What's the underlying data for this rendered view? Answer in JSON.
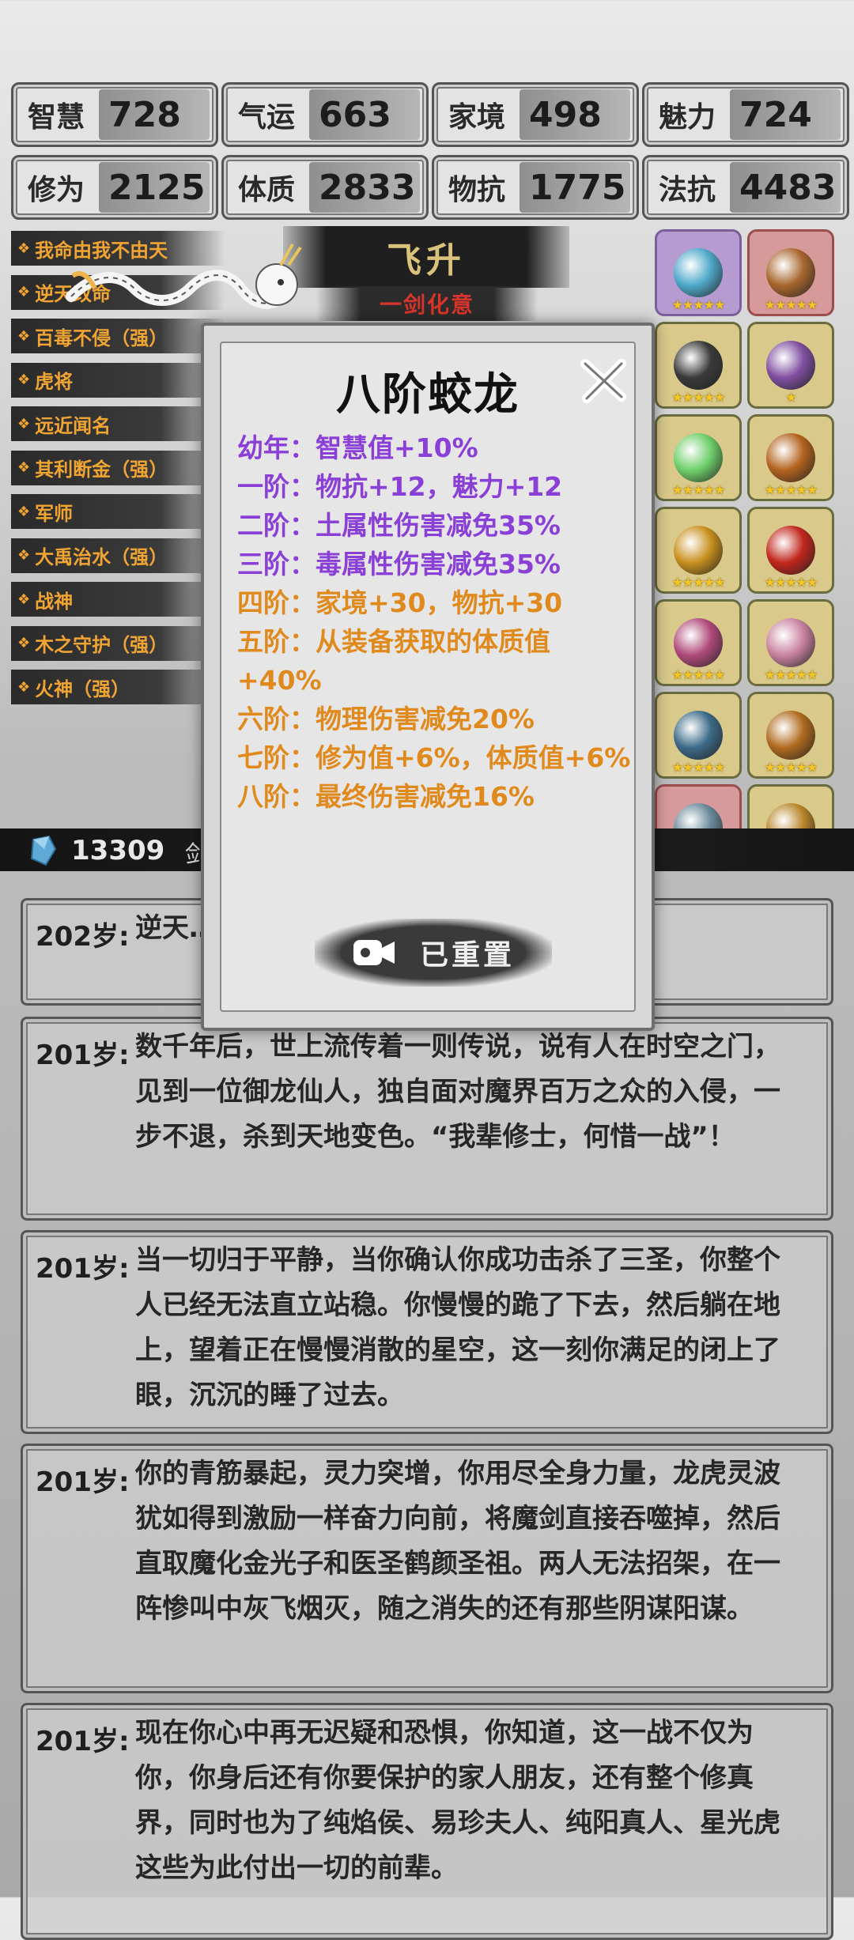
{
  "stats": [
    {
      "label": "智慧",
      "value": "728"
    },
    {
      "label": "气运",
      "value": "663"
    },
    {
      "label": "家境",
      "value": "498"
    },
    {
      "label": "魅力",
      "value": "724"
    },
    {
      "label": "修为",
      "value": "2125"
    },
    {
      "label": "体质",
      "value": "2833"
    },
    {
      "label": "物抗",
      "value": "1775"
    },
    {
      "label": "法抗",
      "value": "4483"
    }
  ],
  "traits": [
    "我命由我不由天",
    "逆天改命",
    "百毒不侵（强）",
    "虎将",
    "远近闻名",
    "其利断金（强）",
    "军师",
    "大禹治水（强）",
    "战神",
    "木之守护（强）",
    "火神（强）"
  ],
  "header": {
    "title": "飞升",
    "subtitle": "一剑化意"
  },
  "equipment": [
    {
      "stars": "★★★★★",
      "frame": "purple",
      "color": "#4fa9c9"
    },
    {
      "stars": "★★★★★",
      "frame": "red",
      "color": "#a8662e"
    },
    {
      "stars": "★★★★★",
      "frame": "gold",
      "color": "#3a3a3a"
    },
    {
      "stars": "★",
      "frame": "gold",
      "color": "#7f4fa0"
    },
    {
      "stars": "★★★★★",
      "frame": "gold",
      "color": "#6fcf6a"
    },
    {
      "stars": "★★★★★",
      "frame": "gold",
      "color": "#b3621e"
    },
    {
      "stars": "★★★★★",
      "frame": "gold",
      "color": "#c8901e"
    },
    {
      "stars": "★★★★★",
      "frame": "gold",
      "color": "#c1261c"
    },
    {
      "stars": "★★★★★",
      "frame": "gold",
      "color": "#b04a7a"
    },
    {
      "stars": "★★★★★",
      "frame": "gold",
      "color": "#c9839f"
    },
    {
      "stars": "★★★★★",
      "frame": "gold",
      "color": "#3c6a88"
    },
    {
      "stars": "★★★★★",
      "frame": "gold",
      "color": "#b06a1e"
    },
    {
      "stars": "★★★★★",
      "frame": "red",
      "color": "#6a8a9a"
    },
    {
      "stars": "★",
      "frame": "gold",
      "color": "#b8862a"
    }
  ],
  "resources": {
    "spirit_stone": "13309",
    "trailing_text": "剑"
  },
  "log": [
    {
      "age": "202岁:",
      "text": "逆天……各种劫数者，万……"
    },
    {
      "age": "201岁:",
      "text": "数千年后，世上流传着一则传说，说有人在时空之门，见到一位御龙仙人，独自面对魔界百万之众的入侵，一步不退，杀到天地变色。“我辈修士，何惜一战”！"
    },
    {
      "age": "201岁:",
      "text": "当一切归于平静，当你确认你成功击杀了三圣，你整个人已经无法直立站稳。你慢慢的跪了下去，然后躺在地上，望着正在慢慢消散的星空，这一刻你满足的闭上了眼，沉沉的睡了过去。"
    },
    {
      "age": "201岁:",
      "text": "你的青筋暴起，灵力突增，你用尽全身力量，龙虎灵波犹如得到激励一样奋力向前，将魔剑直接吞噬掉，然后直取魔化金光子和医圣鹤颜圣祖。两人无法招架，在一阵惨叫中灰飞烟灭，随之消失的还有那些阴谋阳谋。"
    },
    {
      "age": "201岁:",
      "text": "现在你心中再无迟疑和恐惧，你知道，这一战不仅为你，你身后还有你要保护的家人朋友，还有整个修真界，同时也为了纯焰侯、易珍夫人、纯阳真人、星光虎这些为此付出一切的前辈。"
    }
  ],
  "modal": {
    "title": "八阶蛟龙",
    "stages": [
      {
        "stage": "幼年：",
        "effect": "智慧值+10%",
        "tone": "purple"
      },
      {
        "stage": "一阶：",
        "effect": "物抗+12，魅力+12",
        "tone": "purple"
      },
      {
        "stage": "二阶：",
        "effect": "土属性伤害减免35%",
        "tone": "purple"
      },
      {
        "stage": "三阶：",
        "effect": "毒属性伤害减免35%",
        "tone": "purple"
      },
      {
        "stage": "四阶：",
        "effect": "家境+30，物抗+30",
        "tone": "orange"
      },
      {
        "stage": "五阶：",
        "effect": "从装备获取的体质值+40%",
        "tone": "orange"
      },
      {
        "stage": "六阶：",
        "effect": "物理伤害减免20%",
        "tone": "orange"
      },
      {
        "stage": "七阶：",
        "effect": "修为值+6%，体质值+6%",
        "tone": "orange"
      },
      {
        "stage": "八阶：",
        "effect": "最终伤害减免16%",
        "tone": "orange"
      }
    ],
    "reset_label": "已重置"
  },
  "colors": {
    "purple": "#8a3fd6",
    "orange": "#e08a1e",
    "trait_text": "#f0a433",
    "title_gold": "#d9c37a",
    "subtitle_red": "#d9342b"
  }
}
